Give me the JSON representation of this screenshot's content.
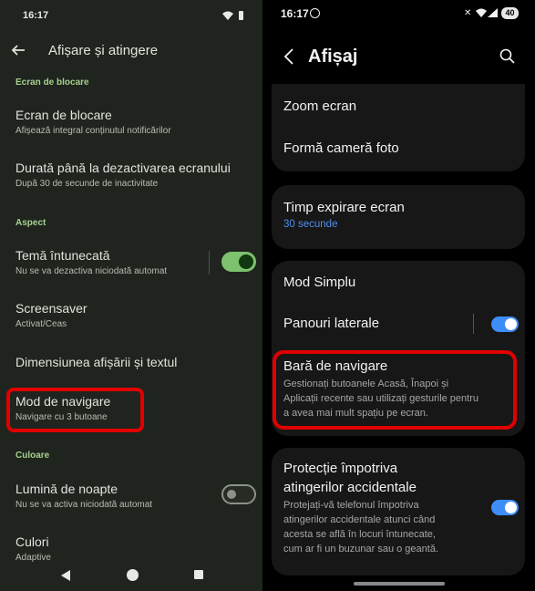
{
  "left": {
    "status_time": "16:17",
    "header_title": "Afișare și atingere",
    "sections": {
      "lock": "Ecran de blocare",
      "aspect": "Aspect",
      "color": "Culoare"
    },
    "items": {
      "lockscreen": {
        "title": "Ecran de blocare",
        "sub": "Afișează integral conținutul notificărilor"
      },
      "timeout": {
        "title": "Durată până la dezactivarea ecranului",
        "sub": "După 30 de secunde de inactivitate"
      },
      "dark_theme": {
        "title": "Temă întunecată",
        "sub": "Nu se va dezactiva niciodată automat",
        "toggle_on": true
      },
      "screensaver": {
        "title": "Screensaver",
        "sub": "Activat/Ceas"
      },
      "display_size": {
        "title": "Dimensiunea afișării și textul"
      },
      "nav_mode": {
        "title": "Mod de navigare",
        "sub": "Navigare cu 3 butoane"
      },
      "night_light": {
        "title": "Lumină de noapte",
        "sub": "Nu se va activa niciodată automat",
        "toggle_on": false
      },
      "colors": {
        "title": "Culori",
        "sub": "Adaptive"
      }
    }
  },
  "right": {
    "status_time": "16:17",
    "battery": "40",
    "header_title": "Afișaj",
    "items": {
      "zoom": {
        "title": "Zoom ecran"
      },
      "camera_cutout": {
        "title": "Formă cameră foto"
      },
      "screen_timeout": {
        "title": "Timp expirare ecran",
        "sub": "30 secunde"
      },
      "easy_mode": {
        "title": "Mod Simplu"
      },
      "edge_panels": {
        "title": "Panouri laterale",
        "toggle_on": true
      },
      "nav_bar": {
        "title": "Bară de navigare",
        "desc_1": "Gestionați butoanele Acasă, Înapoi și",
        "desc_2": "Aplicații recente sau utilizați gesturile pentru",
        "desc_3": "a avea mai mult spațiu pe ecran."
      },
      "accidental": {
        "title_1": "Protecție împotriva",
        "title_2": "atingerilor accidentale",
        "desc_1": "Protejați-vă telefonul împotriva",
        "desc_2": "atingerilor accidentale atunci când",
        "desc_3": "acesta se află în locuri întunecate,",
        "desc_4": "cum ar fi un buzunar sau o geantă.",
        "toggle_on": true
      }
    }
  },
  "colors": {
    "highlight": "#e00000",
    "pixel_accent": "#a8d08d",
    "samsung_accent": "#3e8ef7"
  }
}
